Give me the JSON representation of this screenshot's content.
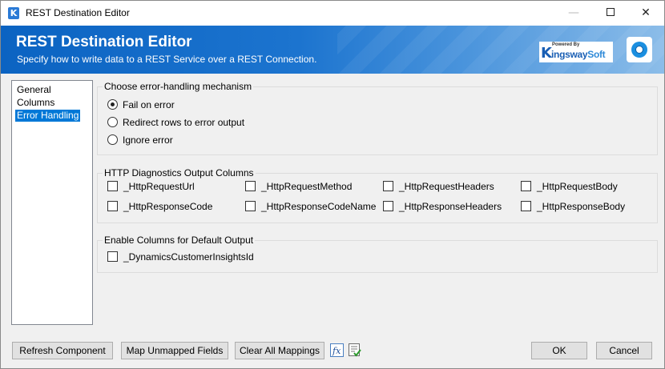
{
  "window": {
    "title": "REST Destination Editor"
  },
  "banner": {
    "title": "REST Destination Editor",
    "subtitle": "Specify how to write data to a REST Service over a REST Connection.",
    "logo": {
      "powered": "Powered By",
      "k": "K",
      "name_a": "ingsway",
      "name_b": "Soft"
    }
  },
  "nav": {
    "items": [
      {
        "label": "General",
        "selected": false
      },
      {
        "label": "Columns",
        "selected": false
      },
      {
        "label": "Error Handling",
        "selected": true
      }
    ]
  },
  "error_handling": {
    "label": "Choose error-handling mechanism",
    "options": [
      {
        "label": "Fail on error",
        "checked": true
      },
      {
        "label": "Redirect rows to error output",
        "checked": false
      },
      {
        "label": "Ignore error",
        "checked": false
      }
    ]
  },
  "diagnostics": {
    "label": "HTTP Diagnostics Output Columns",
    "columns": [
      {
        "label": "_HttpRequestUrl",
        "checked": false
      },
      {
        "label": "_HttpRequestMethod",
        "checked": false
      },
      {
        "label": "_HttpRequestHeaders",
        "checked": false
      },
      {
        "label": "_HttpRequestBody",
        "checked": false
      },
      {
        "label": "_HttpResponseCode",
        "checked": false
      },
      {
        "label": "_HttpResponseCodeName",
        "checked": false
      },
      {
        "label": "_HttpResponseHeaders",
        "checked": false
      },
      {
        "label": "_HttpResponseBody",
        "checked": false
      }
    ]
  },
  "default_output": {
    "label": "Enable Columns for Default Output",
    "columns": [
      {
        "label": "_DynamicsCustomerInsightsId",
        "checked": false
      }
    ]
  },
  "buttons": {
    "refresh": "Refresh Component",
    "map_unmapped": "Map Unmapped Fields",
    "clear_mappings": "Clear All Mappings",
    "ok": "OK",
    "cancel": "Cancel"
  },
  "icons": {
    "app": "kingswaysoft-k-icon",
    "expression": "fx-expression-icon",
    "validate": "validate-checklist-icon"
  }
}
